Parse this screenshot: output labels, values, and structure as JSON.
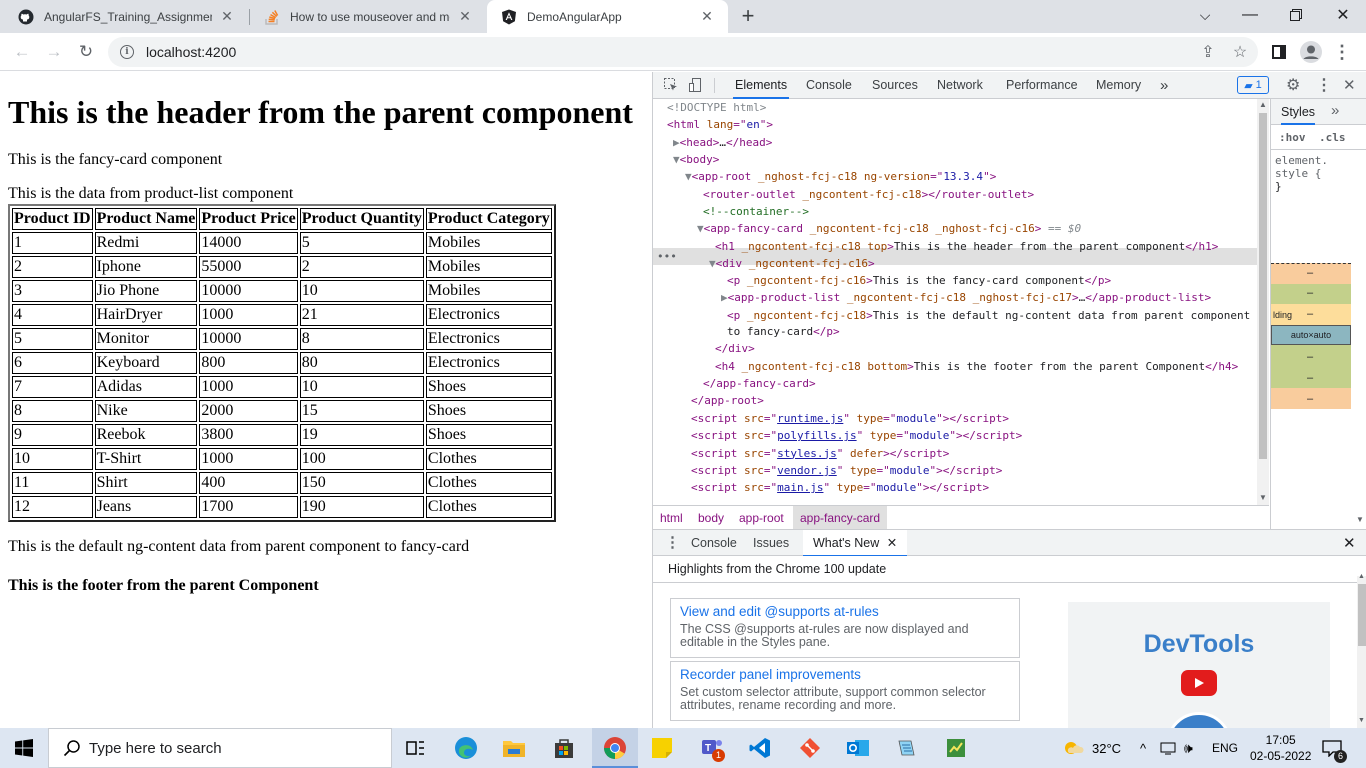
{
  "browser": {
    "tabs": [
      {
        "title": "AngularFS_Training_Assignments",
        "icon": "github-icon",
        "active": false
      },
      {
        "title": "How to use mouseover and mouseout",
        "icon": "stackoverflow-icon",
        "active": false
      },
      {
        "title": "DemoAngularApp",
        "icon": "angular-icon",
        "active": true
      }
    ],
    "new_tab": "+",
    "url": "localhost:4200"
  },
  "page": {
    "header": "This is the header from the parent component",
    "fancy_card_text": "This is the fancy-card component",
    "product_list_text": "This is the data from product-list component",
    "table": {
      "columns": [
        "Product ID",
        "Product Name",
        "Product Price",
        "Product Quantity",
        "Product Category"
      ],
      "rows": [
        [
          "1",
          "Redmi",
          "14000",
          "5",
          "Mobiles"
        ],
        [
          "2",
          "Iphone",
          "55000",
          "2",
          "Mobiles"
        ],
        [
          "3",
          "Jio Phone",
          "10000",
          "10",
          "Mobiles"
        ],
        [
          "4",
          "HairDryer",
          "1000",
          "21",
          "Electronics"
        ],
        [
          "5",
          "Monitor",
          "10000",
          "8",
          "Electronics"
        ],
        [
          "6",
          "Keyboard",
          "800",
          "80",
          "Electronics"
        ],
        [
          "7",
          "Adidas",
          "1000",
          "10",
          "Shoes"
        ],
        [
          "8",
          "Nike",
          "2000",
          "15",
          "Shoes"
        ],
        [
          "9",
          "Reebok",
          "3800",
          "19",
          "Shoes"
        ],
        [
          "10",
          "T-Shirt",
          "1000",
          "100",
          "Clothes"
        ],
        [
          "11",
          "Shirt",
          "400",
          "150",
          "Clothes"
        ],
        [
          "12",
          "Jeans",
          "1700",
          "190",
          "Clothes"
        ]
      ]
    },
    "default_content": "This is the default ng-content data from parent component to fancy-card",
    "footer": "This is the footer from the parent Component"
  },
  "devtools": {
    "tabs": [
      "Elements",
      "Console",
      "Sources",
      "Network",
      "Performance",
      "Memory"
    ],
    "more": "»",
    "issues_count": "1",
    "dom_lines": [
      "<!DOCTYPE html>",
      "<html lang=\"en\">",
      "▶<head>…</head>",
      "▼<body>",
      "▼<app-root _nghost-fcj-c18 ng-version=\"13.3.4\">",
      "<router-outlet _ngcontent-fcj-c18></router-outlet>",
      "<!--container-->",
      "▼<app-fancy-card _ngcontent-fcj-c18 _nghost-fcj-c16>",
      "<h1 _ngcontent-fcj-c18 top>This is the header from the parent component</h1>",
      "▼<div _ngcontent-fcj-c16>",
      "<p _ngcontent-fcj-c16>This is the fancy-card component</p>",
      "▶<app-product-list _ngcontent-fcj-c18 _nghost-fcj-c17>…</app-product-list>",
      "<p _ngcontent-fcj-c18>This is the default ng-content data from parent component",
      "to fancy-card</p>",
      "</div>",
      "<h4 _ngcontent-fcj-c18 bottom>This is the footer from the parent Component</h4>",
      "</app-fancy-card>",
      "</app-root>"
    ],
    "selected_suffix": "== $0",
    "scripts": [
      {
        "src": "runtime.js",
        "attr": "type=\"module\""
      },
      {
        "src": "polyfills.js",
        "attr": "type=\"module\""
      },
      {
        "src": "styles.js",
        "attr": "defer"
      },
      {
        "src": "vendor.js",
        "attr": "type=\"module\""
      },
      {
        "src": "main.js",
        "attr": "type=\"module\""
      }
    ],
    "breadcrumbs": [
      "html",
      "body",
      "app-root",
      "app-fancy-card"
    ],
    "styles": {
      "tab": "Styles",
      "hov": ":hov",
      "cls": ".cls",
      "element_style": "element.",
      "style_line": "style {",
      "close_brace": "}",
      "dash": "–",
      "lding": "lding",
      "auto": "auto×auto"
    },
    "drawer": {
      "tabs": [
        "Console",
        "Issues",
        "What's New"
      ],
      "highlights": "Highlights from the Chrome 100 update",
      "cards": [
        {
          "title": "View and edit @supports at-rules",
          "desc": "The CSS @supports at-rules are now displayed and editable in the Styles pane."
        },
        {
          "title": "Recorder panel improvements",
          "desc": "Set custom selector attribute, support common selector attributes, rename recording and more."
        }
      ],
      "banner": "DevTools"
    }
  },
  "taskbar": {
    "search_placeholder": "Type here to search",
    "weather": "32°C",
    "language": "ENG",
    "time": "17:05",
    "date": "02-05-2022",
    "notifications": "6",
    "teams_badge": "1"
  },
  "colors": {
    "accent": "#1a73e8",
    "tag": "#881280",
    "attr_name": "#994500",
    "attr_value": "#1a1aa6",
    "comment": "#236e25"
  }
}
